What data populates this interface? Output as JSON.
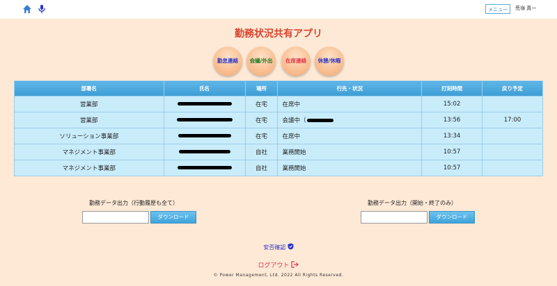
{
  "header": {
    "menu_label": "メニュー",
    "user_name": "荒嶺 真一"
  },
  "title": "勤務状況共有アプリ",
  "status_buttons": [
    {
      "label": "勤怠連絡",
      "color": "#2a34c9"
    },
    {
      "label": "会議/外出",
      "color": "#1f7a24"
    },
    {
      "label": "在席連絡",
      "color": "#e0334a"
    },
    {
      "label": "休憩/休暇",
      "color": "#2a34c9"
    }
  ],
  "table": {
    "headers": [
      "部署名",
      "氏名",
      "場所",
      "行先・状況",
      "打刻時間",
      "戻り予定"
    ],
    "rows": [
      {
        "dept": "営業部",
        "place": "在宅",
        "status": "在席中",
        "time": "15:02",
        "return": ""
      },
      {
        "dept": "営業部",
        "place": "在宅",
        "status": "会議中（",
        "time": "13:56",
        "return": "17:00"
      },
      {
        "dept": "ソリューション事業部",
        "place": "在宅",
        "status": "在席中",
        "time": "13:34",
        "return": ""
      },
      {
        "dept": "マネジメント事業部",
        "place": "自社",
        "status": "業務開始",
        "time": "10:57",
        "return": ""
      },
      {
        "dept": "マネジメント事業部",
        "place": "自社",
        "status": "業務開始",
        "time": "10:57",
        "return": ""
      }
    ]
  },
  "downloads": {
    "left_label": "勤務データ出力（行動履歴も全て）",
    "right_label": "勤務データ出力（開始・終了のみ）",
    "button_label": "ダウンロード"
  },
  "footer": {
    "safety_label": "安否確認",
    "logout_label": "ログアウト",
    "copyright": "© Power Management, Ltd. 2022 All Rights Reserved."
  }
}
